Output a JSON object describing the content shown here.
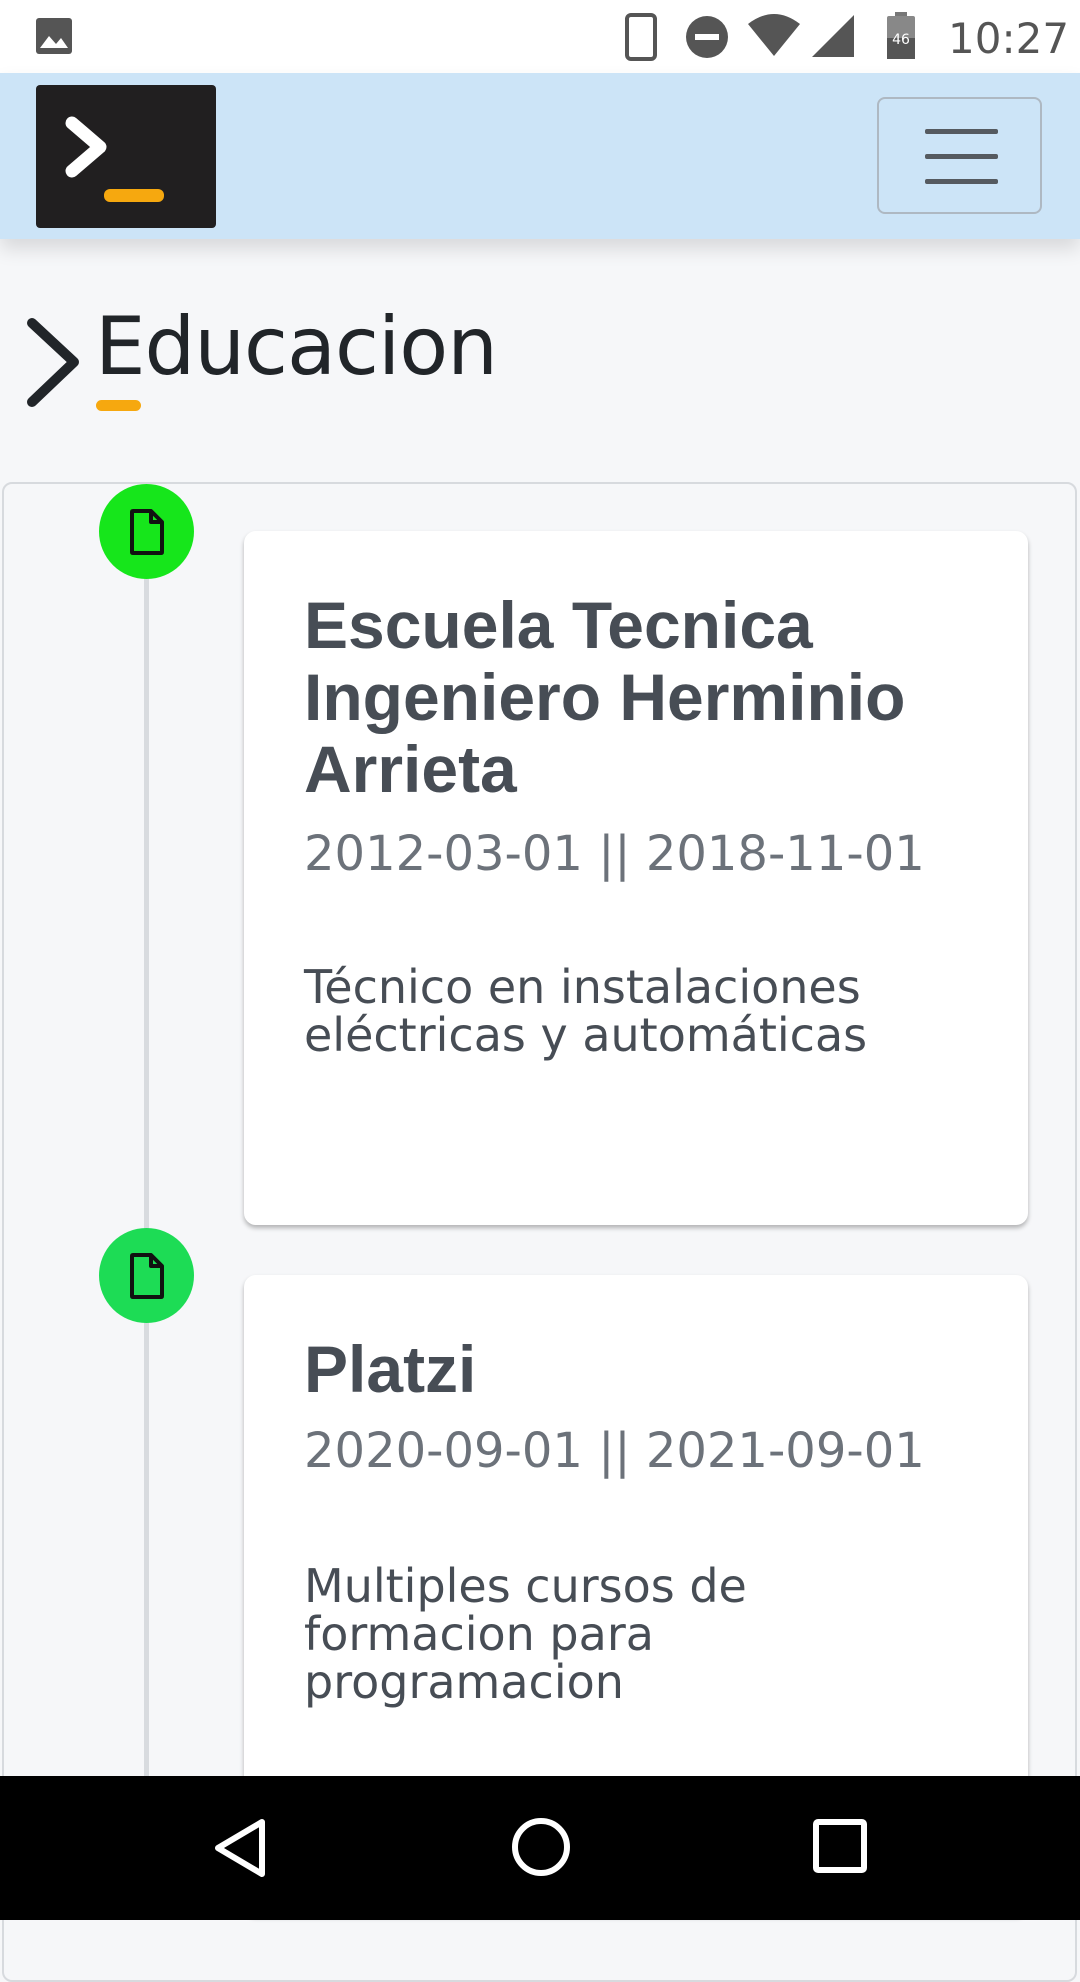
{
  "status_bar": {
    "time": "10:27",
    "battery_level": "46",
    "icons": [
      "gallery-icon",
      "phone-icon",
      "dnd-icon",
      "wifi-icon",
      "signal-icon",
      "battery-icon"
    ]
  },
  "navbar": {
    "brand_icon": "terminal-prompt-icon",
    "menu_icon": "hamburger-menu-icon"
  },
  "section": {
    "title": "Educacion",
    "icon": "chevron-right-icon"
  },
  "colors": {
    "accent": "#f6a80f",
    "navbar_bg": "#cce4f7",
    "dot_1": "#16e61b",
    "dot_2": "#1ddc55"
  },
  "education": [
    {
      "institution": "Escuela Tecnica Ingeniero Herminio Arrieta",
      "dates": "2012-03-01 || 2018-11-01",
      "description": "Técnico en instalaciones eléctricas y automáticas",
      "icon": "document-icon"
    },
    {
      "institution": "Platzi",
      "dates": "2020-09-01 || 2021-09-01",
      "description": "Multiples cursos de formacion para programacion",
      "icon": "document-icon"
    }
  ],
  "system_nav": {
    "icons": [
      "back-icon",
      "home-icon",
      "recents-icon"
    ]
  }
}
